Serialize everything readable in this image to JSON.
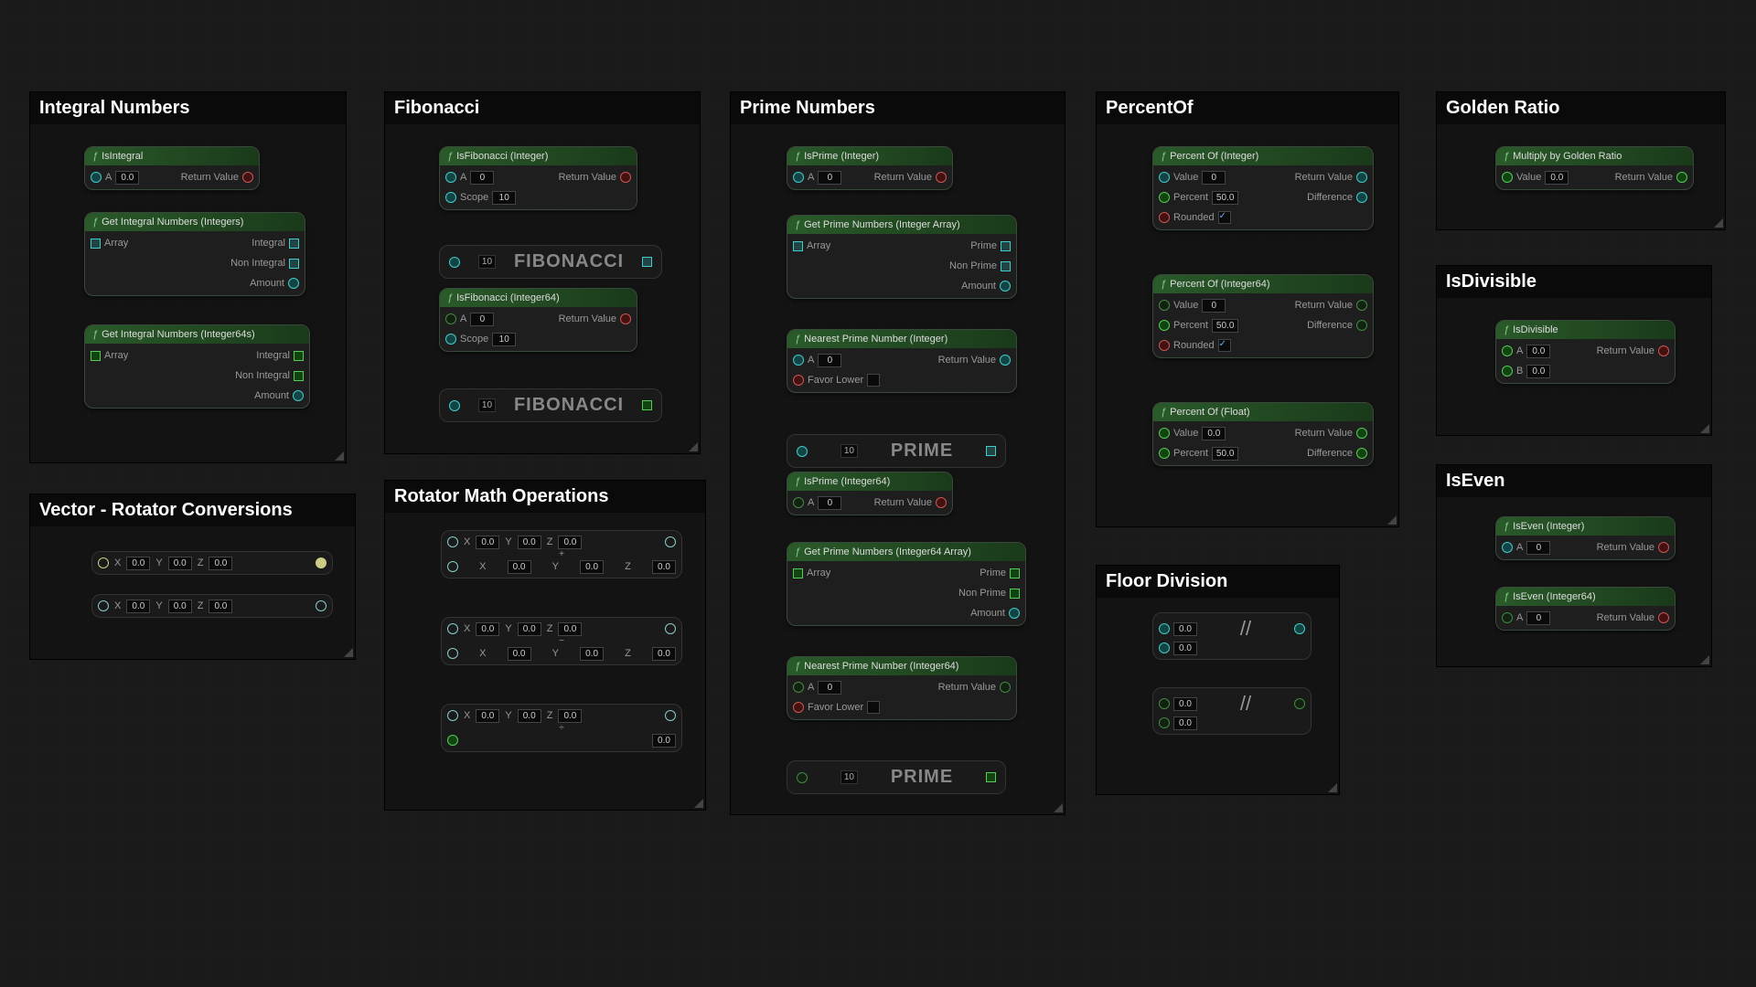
{
  "sections": {
    "integral": "Integral Numbers",
    "fibonacci": "Fibonacci",
    "prime": "Prime Numbers",
    "percentof": "PercentOf",
    "golden": "Golden Ratio",
    "vecrot": "Vector - Rotator Conversions",
    "rotmath": "Rotator Math Operations",
    "floordiv": "Floor Division",
    "isdiv": "IsDivisible",
    "iseven": "IsEven"
  },
  "lbl": {
    "return": "Return Value",
    "integral": "Integral",
    "nonintegral": "Non Integral",
    "amount": "Amount",
    "array": "Array",
    "a": "A",
    "b": "B",
    "scope": "Scope",
    "value": "Value",
    "percent": "Percent",
    "rounded": "Rounded",
    "difference": "Difference",
    "prime": "Prime",
    "nonprime": "Non Prime",
    "favorlower": "Favor Lower",
    "x": "X",
    "y": "Y",
    "z": "Z"
  },
  "v": {
    "f0": "0.0",
    "i0": "0",
    "i10": "10",
    "p50": "50.0"
  },
  "nodes": {
    "isintegral": "IsIntegral",
    "getint": "Get Integral Numbers (Integers)",
    "getint64": "Get Integral Numbers (Integer64s)",
    "isfib": "IsFibonacci (Integer)",
    "isfib64": "IsFibonacci (Integer64)",
    "isprime": "IsPrime (Integer)",
    "isprime64": "IsPrime (Integer64)",
    "getprime": "Get Prime Numbers (Integer Array)",
    "getprime64": "Get Prime Numbers (Integer64 Array)",
    "nearprime": "Nearest Prime Number (Integer)",
    "nearprime64": "Nearest Prime Number (Integer64)",
    "pctint": "Percent Of (Integer)",
    "pctint64": "Percent Of (Integer64)",
    "pctfloat": "Percent Of (Float)",
    "mulgold": "Multiply by Golden Ratio",
    "isdiv": "IsDivisible",
    "isevenint": "IsEven (Integer)",
    "isevenint64": "IsEven (Integer64)"
  },
  "macro": {
    "fib": "FIBONACCI",
    "prime": "PRIME",
    "floordiv": "//"
  }
}
